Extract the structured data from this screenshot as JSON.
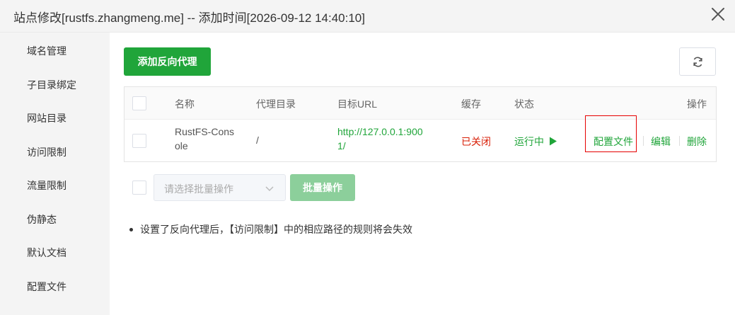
{
  "dialog": {
    "title": "站点修改[rustfs.zhangmeng.me] -- 添加时间[2026-09-12 14:40:10]"
  },
  "sidebar": {
    "items": [
      {
        "label": "域名管理"
      },
      {
        "label": "子目录绑定"
      },
      {
        "label": "网站目录"
      },
      {
        "label": "访问限制"
      },
      {
        "label": "流量限制"
      },
      {
        "label": "伪静态"
      },
      {
        "label": "默认文档"
      },
      {
        "label": "配置文件"
      }
    ]
  },
  "toolbar": {
    "add_label": "添加反向代理"
  },
  "table": {
    "headers": {
      "name": "名称",
      "dir": "代理目录",
      "url": "目标URL",
      "cache": "缓存",
      "status": "状态",
      "ops": "操作"
    },
    "rows": [
      {
        "name_line1": "RustFS-Cons",
        "name_line2": "ole",
        "dir": "/",
        "url_line1": "http://127.0.0.1:900",
        "url_line2": "1/",
        "cache": "已关闭",
        "status": "运行中",
        "op_config": "配置文件",
        "op_edit": "编辑",
        "op_delete": "删除"
      }
    ]
  },
  "batch": {
    "placeholder": "请选择批量操作",
    "button_label": "批量操作"
  },
  "notes": [
    "设置了反向代理后，【访问限制】中的相应路径的规则将会失效"
  ],
  "colors": {
    "primary_green": "#20a53a",
    "danger_red": "#d81e06",
    "highlight_red": "#e60000"
  }
}
